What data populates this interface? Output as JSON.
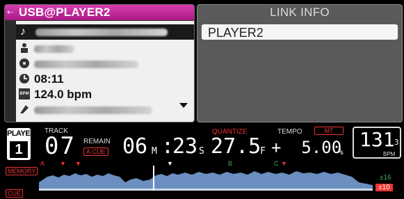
{
  "source": {
    "title": "USB@PLAYER2"
  },
  "track_info": {
    "time": "08:11",
    "bpm": "124.0 bpm",
    "bpm_badge": "BPM"
  },
  "link_info": {
    "title": "LINK INFO",
    "items": [
      "PLAYER2"
    ]
  },
  "status": {
    "player_label": "PLAYER",
    "player_number": "1",
    "track_label": "TRACK",
    "track_number": "07",
    "remain_label": "REMAIN",
    "acue_label": "A.CUE",
    "time_min": "06",
    "min_unit": "M",
    "time_sec": "23",
    "sec_unit": "S",
    "time_frame": "27.5",
    "frame_unit": "F",
    "quantize_label": "QUANTIZE",
    "tempo_label": "TEMPO",
    "mt_label": "MT",
    "tempo_value": "+  5.00",
    "percent_unit": "%",
    "bpm_int": "131",
    "bpm_dec": "3",
    "bpm_unit": "BPM"
  },
  "waveform": {
    "memory_label": "MEMORY",
    "cue_label": "CUE",
    "marker_a": "A",
    "marker_b": "B",
    "marker_c": "C",
    "range_16": "±16",
    "range_10": "±10"
  },
  "colors": {
    "title_bar": "#c22a9c",
    "accent_red": "#e33333",
    "wave_blue": "#6a8fc0",
    "marker_green": "#4caf50"
  }
}
